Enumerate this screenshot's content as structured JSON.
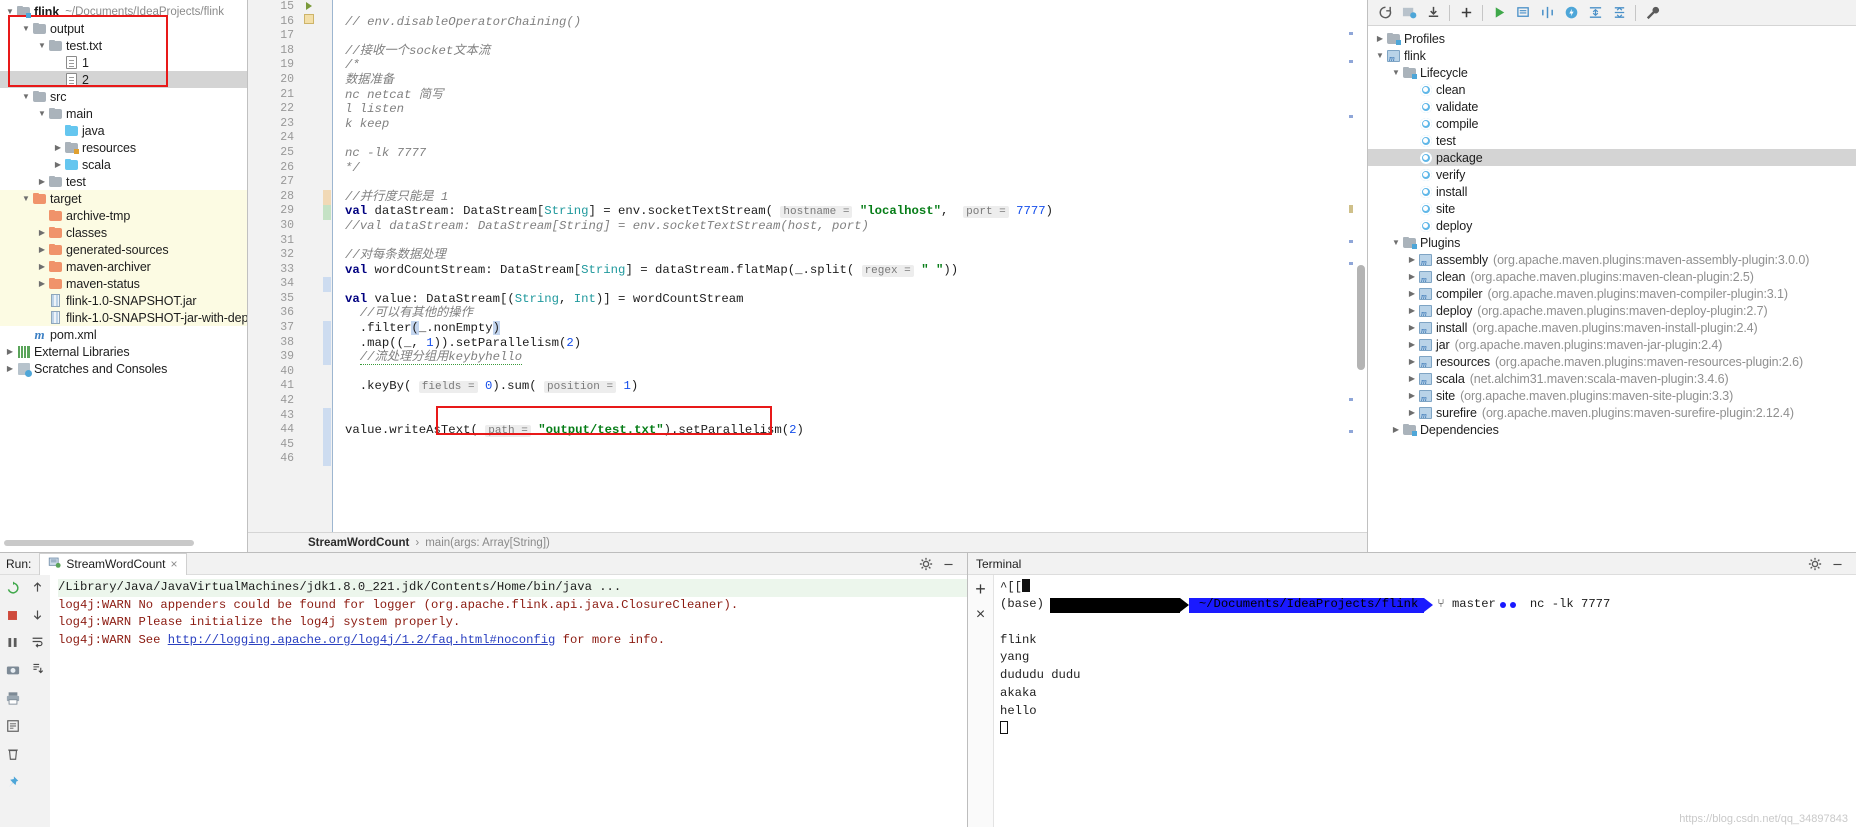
{
  "project": {
    "root": {
      "label": "flink",
      "path": "~/Documents/IdeaProjects/flink"
    },
    "nodes": [
      {
        "label": "output",
        "icon": "folder-icon",
        "indent": 1,
        "arrow": "down",
        "kind": "folder"
      },
      {
        "label": "test.txt",
        "icon": "folder-icon",
        "indent": 2,
        "arrow": "down",
        "kind": "folder"
      },
      {
        "label": "1",
        "icon": "file-icon",
        "indent": 3,
        "arrow": "none",
        "kind": "file"
      },
      {
        "label": "2",
        "icon": "file-icon",
        "indent": 3,
        "arrow": "none",
        "kind": "file",
        "selected": true
      },
      {
        "label": "src",
        "icon": "folder-icon",
        "indent": 1,
        "arrow": "down",
        "kind": "folder"
      },
      {
        "label": "main",
        "icon": "folder-icon",
        "indent": 2,
        "arrow": "down",
        "kind": "folder"
      },
      {
        "label": "java",
        "icon": "folder-source-icon",
        "indent": 3,
        "arrow": "none",
        "kind": "source"
      },
      {
        "label": "resources",
        "icon": "folder-resources-icon",
        "indent": 3,
        "arrow": "right",
        "kind": "resources"
      },
      {
        "label": "scala",
        "icon": "folder-source-icon",
        "indent": 3,
        "arrow": "right",
        "kind": "source"
      },
      {
        "label": "test",
        "icon": "folder-icon",
        "indent": 2,
        "arrow": "right",
        "kind": "folder"
      },
      {
        "label": "target",
        "icon": "folder-excluded-icon",
        "indent": 1,
        "arrow": "down",
        "kind": "excluded",
        "excluded": true
      },
      {
        "label": "archive-tmp",
        "icon": "folder-excluded-icon",
        "indent": 2,
        "arrow": "none",
        "kind": "excluded",
        "excluded": true
      },
      {
        "label": "classes",
        "icon": "folder-excluded-icon",
        "indent": 2,
        "arrow": "right",
        "kind": "excluded",
        "excluded": true
      },
      {
        "label": "generated-sources",
        "icon": "folder-excluded-icon",
        "indent": 2,
        "arrow": "right",
        "kind": "excluded",
        "excluded": true
      },
      {
        "label": "maven-archiver",
        "icon": "folder-excluded-icon",
        "indent": 2,
        "arrow": "right",
        "kind": "excluded",
        "excluded": true
      },
      {
        "label": "maven-status",
        "icon": "folder-excluded-icon",
        "indent": 2,
        "arrow": "right",
        "kind": "excluded",
        "excluded": true
      },
      {
        "label": "flink-1.0-SNAPSHOT.jar",
        "icon": "jar-icon",
        "indent": 2,
        "arrow": "none",
        "kind": "jar",
        "excluded": true
      },
      {
        "label": "flink-1.0-SNAPSHOT-jar-with-dep",
        "icon": "jar-icon",
        "indent": 2,
        "arrow": "none",
        "kind": "jar",
        "excluded": true
      },
      {
        "label": "pom.xml",
        "icon": "maven-xml-icon",
        "indent": 1,
        "arrow": "none",
        "kind": "pom"
      },
      {
        "label": "External Libraries",
        "icon": "libraries-icon",
        "indent": 0,
        "arrow": "right",
        "kind": "libraries"
      },
      {
        "label": "Scratches and Consoles",
        "icon": "scratches-icon",
        "indent": 0,
        "arrow": "right",
        "kind": "scratches"
      }
    ]
  },
  "editor": {
    "first_line": 15,
    "lines": [
      {
        "n": 15,
        "html": ""
      },
      {
        "n": 16,
        "html": "<span class='cm'>// env.disableOperatorChaining()</span>"
      },
      {
        "n": 17,
        "html": ""
      },
      {
        "n": 18,
        "html": "<span class='cm'>//接收一个socket文本流</span>"
      },
      {
        "n": 19,
        "html": "<span class='cm'>/*</span>"
      },
      {
        "n": 20,
        "html": "<span class='cm'>数据准备</span>"
      },
      {
        "n": 21,
        "html": "<span class='cm'>nc netcat 简写</span>"
      },
      {
        "n": 22,
        "html": "<span class='cm'>l listen</span>"
      },
      {
        "n": 23,
        "html": "<span class='cm'>k keep</span>"
      },
      {
        "n": 24,
        "html": ""
      },
      {
        "n": 25,
        "html": "<span class='cm'>nc -lk 7777</span>"
      },
      {
        "n": 26,
        "html": "<span class='cm'>*/</span>"
      },
      {
        "n": 27,
        "html": ""
      },
      {
        "n": 28,
        "html": "<span class='cm'>//并行度只能是 1</span>"
      },
      {
        "n": 29,
        "html": "<span class='k'>val</span> dataStream: DataStream[<span class='ty'>String</span>] = env.socketTextStream( <span class='hint'>hostname =</span> <span class='st'>\"localhost\"</span>,  <span class='hint'>port =</span> <span class='num'>7777</span>)"
      },
      {
        "n": 30,
        "html": "<span class='cm'>//val dataStream: DataStream[String] = env.socketTextStream(host, port)</span>"
      },
      {
        "n": 31,
        "html": ""
      },
      {
        "n": 32,
        "html": "<span class='cm'>//对每条数据处理</span>"
      },
      {
        "n": 33,
        "html": "<span class='k'>val</span> wordCountStream: DataStream[<span class='ty'>String</span>] = dataStream.flatMap(_.split( <span class='hint'>regex =</span> <span class='st'>\" \"</span>))"
      },
      {
        "n": 34,
        "html": ""
      },
      {
        "n": 35,
        "html": "<span class='k'>val</span> value: DataStream[(<span class='ty'>String</span>, <span class='ty'>Int</span>)] = wordCountStream"
      },
      {
        "n": 36,
        "html": "  <span class='cm'>//可以有其他的操作</span>"
      },
      {
        "n": 37,
        "html": "  .filter<span class='hl'>(</span>_.nonEmpty<span class='hl'>)</span>"
      },
      {
        "n": 38,
        "html": "  .map((_, <span class='num'>1</span>)).setParallelism(<span class='num'>2</span>)"
      },
      {
        "n": 39,
        "html": "  <span class='cm squig'>//流处理分组用keybyhello</span>"
      },
      {
        "n": 40,
        "html": ""
      },
      {
        "n": 41,
        "html": "  .keyBy( <span class='hint'>fields =</span> <span class='num'>0</span>).sum( <span class='hint'>position =</span> <span class='num'>1</span>)"
      },
      {
        "n": 42,
        "html": ""
      },
      {
        "n": 43,
        "html": ""
      },
      {
        "n": 44,
        "html": "value.writeAsText( <span class='hint'>path =</span> <span class='st'>\"output/test.txt\"</span>).setParallelism(<span class='num'>2</span>)"
      },
      {
        "n": 45,
        "html": ""
      },
      {
        "n": 46,
        "html": ""
      }
    ],
    "breadcrumb": {
      "class": "StreamWordCount",
      "separator": "›",
      "method": "main(args: Array[String])"
    }
  },
  "maven": {
    "toolbar_icons": [
      "refresh-icon",
      "generate-sources-icon",
      "download-sources-icon",
      "add-icon",
      "run-maven-build-icon",
      "execute-goal-icon",
      "toggle-skip-tests-icon",
      "toggle-offline-icon",
      "expand-all-icon",
      "collapse-all-icon",
      "settings-wrench-icon"
    ],
    "tree": [
      {
        "label": "Profiles",
        "indent": 0,
        "arrow": "right",
        "icon": "profiles-icon"
      },
      {
        "label": "flink",
        "indent": 0,
        "arrow": "down",
        "icon": "maven-project-icon"
      },
      {
        "label": "Lifecycle",
        "indent": 1,
        "arrow": "down",
        "icon": "lifecycle-icon"
      },
      {
        "label": "clean",
        "indent": 2,
        "arrow": "none",
        "icon": "goal-icon"
      },
      {
        "label": "validate",
        "indent": 2,
        "arrow": "none",
        "icon": "goal-icon"
      },
      {
        "label": "compile",
        "indent": 2,
        "arrow": "none",
        "icon": "goal-icon"
      },
      {
        "label": "test",
        "indent": 2,
        "arrow": "none",
        "icon": "goal-icon"
      },
      {
        "label": "package",
        "indent": 2,
        "arrow": "none",
        "icon": "goal-icon",
        "selected": true
      },
      {
        "label": "verify",
        "indent": 2,
        "arrow": "none",
        "icon": "goal-icon"
      },
      {
        "label": "install",
        "indent": 2,
        "arrow": "none",
        "icon": "goal-icon"
      },
      {
        "label": "site",
        "indent": 2,
        "arrow": "none",
        "icon": "goal-icon"
      },
      {
        "label": "deploy",
        "indent": 2,
        "arrow": "none",
        "icon": "goal-icon"
      },
      {
        "label": "Plugins",
        "indent": 1,
        "arrow": "down",
        "icon": "plugins-icon"
      },
      {
        "label": "assembly",
        "detail": "(org.apache.maven.plugins:maven-assembly-plugin:3.0.0)",
        "indent": 2,
        "arrow": "right",
        "icon": "plugin-icon"
      },
      {
        "label": "clean",
        "detail": "(org.apache.maven.plugins:maven-clean-plugin:2.5)",
        "indent": 2,
        "arrow": "right",
        "icon": "plugin-icon"
      },
      {
        "label": "compiler",
        "detail": "(org.apache.maven.plugins:maven-compiler-plugin:3.1)",
        "indent": 2,
        "arrow": "right",
        "icon": "plugin-icon"
      },
      {
        "label": "deploy",
        "detail": "(org.apache.maven.plugins:maven-deploy-plugin:2.7)",
        "indent": 2,
        "arrow": "right",
        "icon": "plugin-icon"
      },
      {
        "label": "install",
        "detail": "(org.apache.maven.plugins:maven-install-plugin:2.4)",
        "indent": 2,
        "arrow": "right",
        "icon": "plugin-icon"
      },
      {
        "label": "jar",
        "detail": "(org.apache.maven.plugins:maven-jar-plugin:2.4)",
        "indent": 2,
        "arrow": "right",
        "icon": "plugin-icon"
      },
      {
        "label": "resources",
        "detail": "(org.apache.maven.plugins:maven-resources-plugin:2.6)",
        "indent": 2,
        "arrow": "right",
        "icon": "plugin-icon"
      },
      {
        "label": "scala",
        "detail": "(net.alchim31.maven:scala-maven-plugin:3.4.6)",
        "indent": 2,
        "arrow": "right",
        "icon": "plugin-icon"
      },
      {
        "label": "site",
        "detail": "(org.apache.maven.plugins:maven-site-plugin:3.3)",
        "indent": 2,
        "arrow": "right",
        "icon": "plugin-icon"
      },
      {
        "label": "surefire",
        "detail": "(org.apache.maven.plugins:maven-surefire-plugin:2.12.4)",
        "indent": 2,
        "arrow": "right",
        "icon": "plugin-icon"
      },
      {
        "label": "Dependencies",
        "indent": 1,
        "arrow": "right",
        "icon": "dependencies-icon"
      }
    ]
  },
  "run": {
    "label": "Run:",
    "tab": "StreamWordCount",
    "close_label": "×",
    "console": [
      {
        "text": "/Library/Java/JavaVirtualMachines/jdk1.8.0_221.jdk/Contents/Home/bin/java ...",
        "style": "cmd"
      },
      {
        "text": "log4j:WARN No appenders could be found for logger (org.apache.flink.api.java.ClosureCleaner).",
        "style": "warn"
      },
      {
        "text": "log4j:WARN Please initialize the log4j system properly.",
        "style": "warn"
      },
      {
        "text": "log4j:WARN See ",
        "style": "warn",
        "link": "http://logging.apache.org/log4j/1.2/faq.html#noconfig",
        "tail": " for more info."
      }
    ],
    "side_icons": [
      "rerun-icon",
      "stop-icon",
      "pause-icon",
      "camera-icon",
      "print-icon",
      "wrap-icon",
      "scroll-end-icon",
      "clear-all-icon",
      "pin-icon",
      "up-icon",
      "down-icon",
      "soft-wrap-icon",
      "export-icon"
    ]
  },
  "terminal": {
    "title": "Terminal",
    "new_tab_label": "+",
    "close_label": "×",
    "lines": [
      {
        "text": "^[[",
        "type": "raw"
      },
      {
        "type": "prompt",
        "conda": "(base)",
        "path": "~/Documents/IdeaProjects/flink",
        "git": "master",
        "command": "nc -lk 7777"
      },
      {
        "text": "",
        "type": "raw"
      },
      {
        "text": "flink",
        "type": "raw"
      },
      {
        "text": "yang",
        "type": "raw"
      },
      {
        "text": "dududu dudu",
        "type": "raw"
      },
      {
        "text": "akaka",
        "type": "raw"
      },
      {
        "text": "hello",
        "type": "raw"
      },
      {
        "type": "cursor"
      }
    ]
  },
  "watermark": "https://blog.csdn.net/qq_34897843",
  "colors": {
    "selection": "#d4d4d4",
    "excluded_bg": "#fcfbe3",
    "highlight_box": "#e81919",
    "keyword": "#000080",
    "string": "#067d17",
    "comment": "#808080",
    "type": "#20999d",
    "number": "#1750eb",
    "terminal_blue": "#1a1aff"
  }
}
